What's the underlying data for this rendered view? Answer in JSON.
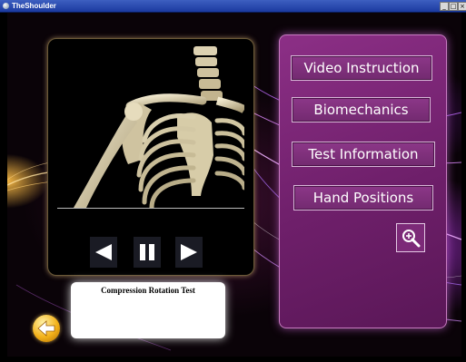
{
  "window": {
    "title": "TheShoulder",
    "controls": {
      "minimize": "_",
      "maximize": "□",
      "close": "×"
    }
  },
  "player": {
    "controls": [
      {
        "name": "previous-button",
        "icon": "triangle-left-icon"
      },
      {
        "name": "pause-button",
        "icon": "pause-icon"
      },
      {
        "name": "play-button",
        "icon": "triangle-right-icon"
      }
    ]
  },
  "test": {
    "title": "Compression Rotation Test"
  },
  "menu": {
    "items": [
      {
        "label": "Video Instruction"
      },
      {
        "label": "Biomechanics"
      },
      {
        "label": "Test Information"
      },
      {
        "label": "Hand Positions"
      }
    ],
    "zoom_icon": "magnifier-plus-icon"
  },
  "back_icon": "arrow-left-icon",
  "colors": {
    "accent": "#8c2f86",
    "button_border": "#d8b7d8",
    "back_button": "#f3b21a"
  }
}
